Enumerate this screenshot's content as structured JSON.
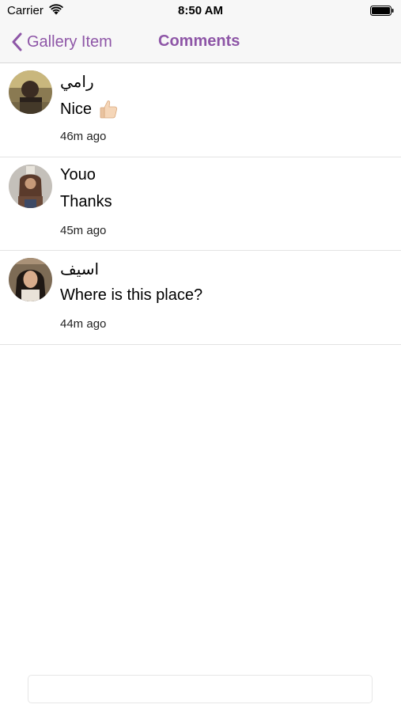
{
  "status_bar": {
    "carrier": "Carrier",
    "time": "8:50 AM",
    "wifi_icon": "wifi-icon",
    "battery_icon": "battery-icon"
  },
  "nav_bar": {
    "back_label": "Gallery Item",
    "back_icon": "chevron-left-icon",
    "title": "Comments",
    "accent_color": "#8e56a7"
  },
  "comments": [
    {
      "author": "رامي",
      "text": "Nice",
      "emoji_icon": "thumbs-up-icon",
      "time": "46m ago"
    },
    {
      "author": "Youo",
      "text": "Thanks",
      "time": "45m ago"
    },
    {
      "author": "اسيف",
      "text": "Where is this place?",
      "time": "44m ago"
    }
  ],
  "comment_input": {
    "placeholder": "",
    "value": ""
  }
}
